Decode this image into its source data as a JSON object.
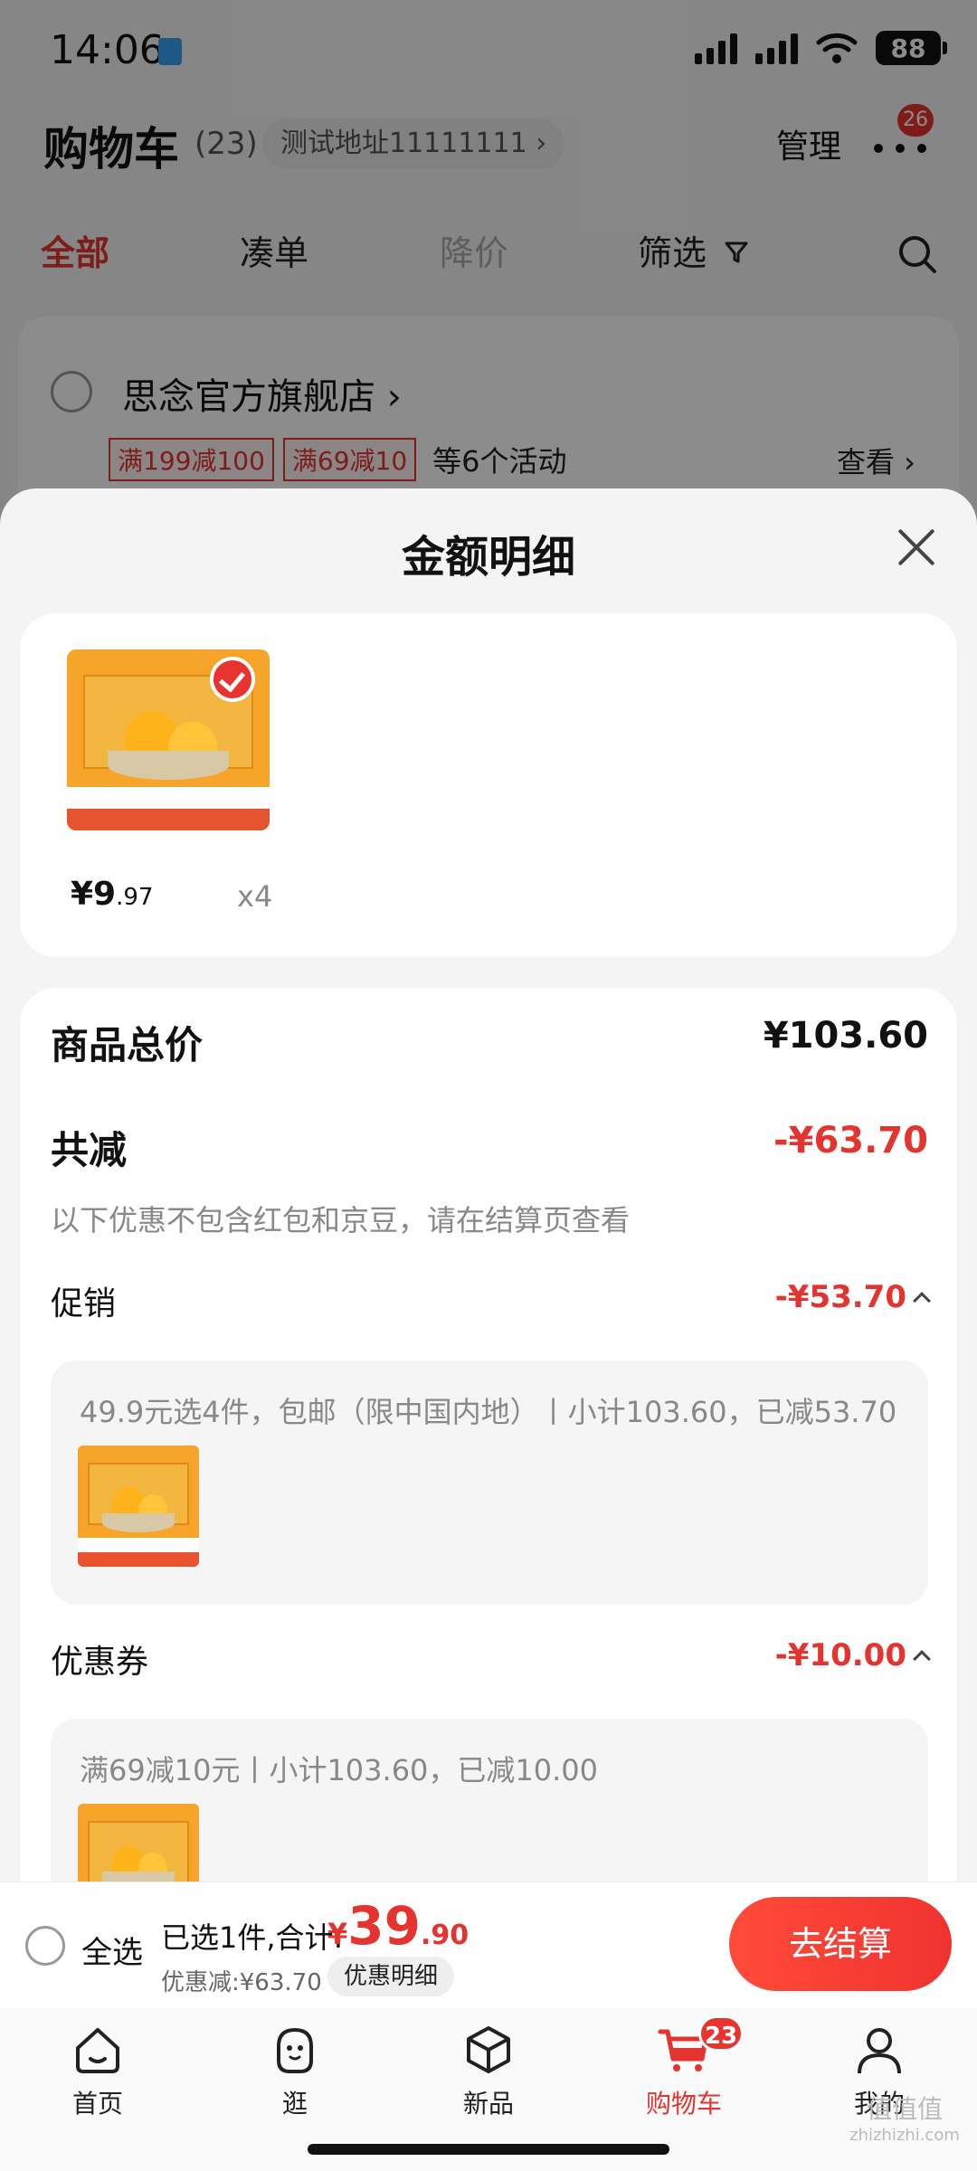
{
  "status_bar": {
    "time": "14:06",
    "battery": "88"
  },
  "header": {
    "title": "购物车",
    "count": "(23)",
    "address": "测试地址11111111 ›",
    "manage": "管理",
    "more_badge": "26"
  },
  "tabs": [
    {
      "label": "全部"
    },
    {
      "label": "凑单"
    },
    {
      "label": "降价"
    },
    {
      "label": "筛选"
    }
  ],
  "shop": {
    "name": "思念官方旗舰店 ›",
    "promo_tags": [
      "满199减100",
      "满69减10"
    ],
    "promo_more": "等6个活动",
    "view": "查看 ›"
  },
  "sheet": {
    "title": "金额明细",
    "product": {
      "price_int": "¥9",
      "price_dec": ".97",
      "qty": "x4"
    },
    "total": {
      "label": "商品总价",
      "value": "¥103.60"
    },
    "reduction": {
      "label": "共减",
      "value": "-¥63.70",
      "note": "以下优惠不包含红包和京豆，请在结算页查看"
    },
    "promotion": {
      "label": "促销",
      "value": "-¥53.70",
      "detail": "49.9元选4件，包邮（限中国内地）丨小计103.60，已减53.70"
    },
    "coupon": {
      "label": "优惠券",
      "value": "-¥10.00",
      "detail": "满69减10元丨小计103.60，已减10.00"
    }
  },
  "bottom_bar": {
    "select_all": "全选",
    "selected_text": "已选1件,合计:",
    "total_currency": "¥",
    "total_int": "39",
    "total_dec": ".90",
    "discount": "优惠减:¥63.70",
    "detail_chip": "优惠明细",
    "checkout": "去结算"
  },
  "tabbar": {
    "items": [
      {
        "label": "首页",
        "icon": "home-icon"
      },
      {
        "label": "逛",
        "icon": "stroll-icon"
      },
      {
        "label": "新品",
        "icon": "cube-icon"
      },
      {
        "label": "购物车",
        "icon": "cart-icon",
        "badge": "23"
      },
      {
        "label": "我的",
        "icon": "profile-icon"
      }
    ]
  },
  "watermark": {
    "text": "值值值",
    "sub": "zhizhizhi.com"
  },
  "colors": {
    "accent": "#e4342f",
    "checkout_button": "#f0322f"
  }
}
